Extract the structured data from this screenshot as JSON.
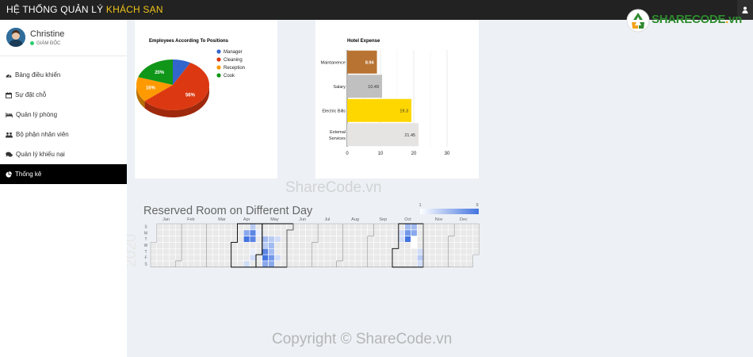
{
  "app": {
    "title_prefix": "HỆ THỐNG QUẢN LÝ",
    "title_highlight": "KHÁCH SẠN"
  },
  "watermark": {
    "logo_main": "SHARECODE",
    "logo_dot": ".",
    "logo_tld": "vn",
    "center_text": "ShareCode.vn",
    "copyright": "Copyright © ShareCode.vn"
  },
  "profile": {
    "name": "Christine",
    "role": "GIÁM ĐỐC"
  },
  "sidebar": {
    "items": [
      {
        "label": "Bảng điều khiển",
        "icon": "dashboard-icon"
      },
      {
        "label": "Sự đặt chỗ",
        "icon": "calendar-icon"
      },
      {
        "label": "Quản lý phòng",
        "icon": "bed-icon"
      },
      {
        "label": "Bộ phận nhân viên",
        "icon": "users-icon"
      },
      {
        "label": "Quản lý khiếu nại",
        "icon": "comments-icon"
      },
      {
        "label": "Thống kê",
        "icon": "pie-chart-icon"
      }
    ],
    "active_index": 5
  },
  "colors": {
    "accent": "#f0c419",
    "topbar": "#222222",
    "active_menu": "#000000",
    "online": "#2ecc71"
  },
  "chart_data": [
    {
      "type": "pie",
      "title": "Employees According To Positions",
      "categories": [
        "Manager",
        "Cleaning",
        "Reception",
        "Cook"
      ],
      "values": [
        8,
        56,
        16,
        20
      ],
      "labels": [
        "",
        "56%",
        "16%",
        "20%"
      ],
      "colors": [
        "#3366cc",
        "#dc3912",
        "#ff9900",
        "#109618"
      ],
      "legend": "right",
      "style": "3d"
    },
    {
      "type": "bar",
      "orientation": "horizontal",
      "title": "Hotel Expense",
      "categories": [
        "Maintanence",
        "Salary",
        "Electric Bills",
        "Extemal Services"
      ],
      "values": [
        8.94,
        10.49,
        19.3,
        21.45
      ],
      "labels": [
        "8.94",
        "10.49",
        "19.3",
        "21.45"
      ],
      "colors": [
        "#b87333",
        "#c0c0c0",
        "#ffd700",
        "#e5e4e2"
      ],
      "xlim": [
        0,
        30
      ],
      "xticks": [
        "0",
        "10",
        "20",
        "30"
      ],
      "grid": true
    },
    {
      "type": "heatmap",
      "subtype": "calendar",
      "title": "Reserved Room on Different Day",
      "year": "2020",
      "months": [
        "Jan",
        "Feb",
        "Mar",
        "Apr",
        "May",
        "Jun",
        "Jul",
        "Aug",
        "Sep",
        "Oct",
        "Nov",
        "Dec"
      ],
      "weekdays": [
        "S",
        "M",
        "T",
        "W",
        "T",
        "F",
        "S"
      ],
      "color_axis": {
        "min": "1",
        "max": "9",
        "min_color": "#ffffff",
        "max_color": "#4374e0"
      },
      "highlighted_months": [
        "Apr",
        "May",
        "Oct"
      ],
      "reservations": [
        {
          "date": "2020-04-13",
          "value": 6
        },
        {
          "date": "2020-04-14",
          "value": 9
        },
        {
          "date": "2020-04-18",
          "value": 3
        },
        {
          "date": "2020-04-19",
          "value": 4
        },
        {
          "date": "2020-04-20",
          "value": 8
        },
        {
          "date": "2020-04-21",
          "value": 8
        },
        {
          "date": "2020-04-23",
          "value": 2
        },
        {
          "date": "2020-04-24",
          "value": 3
        },
        {
          "date": "2020-04-27",
          "value": 2
        },
        {
          "date": "2020-05-05",
          "value": 5
        },
        {
          "date": "2020-05-06",
          "value": 4
        },
        {
          "date": "2020-05-07",
          "value": 8
        },
        {
          "date": "2020-05-08",
          "value": 9
        },
        {
          "date": "2020-05-09",
          "value": 6
        },
        {
          "date": "2020-05-12",
          "value": 4
        },
        {
          "date": "2020-05-13",
          "value": 5
        },
        {
          "date": "2020-05-14",
          "value": 5
        },
        {
          "date": "2020-05-15",
          "value": 7
        },
        {
          "date": "2020-05-16",
          "value": 6
        },
        {
          "date": "2020-05-19",
          "value": 3
        },
        {
          "date": "2020-05-22",
          "value": 3
        },
        {
          "date": "2020-10-05",
          "value": 3
        },
        {
          "date": "2020-10-06",
          "value": 3
        },
        {
          "date": "2020-10-11",
          "value": 5
        },
        {
          "date": "2020-10-12",
          "value": 7
        },
        {
          "date": "2020-10-13",
          "value": 9
        },
        {
          "date": "2020-10-18",
          "value": 5
        },
        {
          "date": "2020-10-19",
          "value": 6
        },
        {
          "date": "2020-10-20",
          "value": 1
        },
        {
          "date": "2020-10-21",
          "value": 1
        },
        {
          "date": "2020-10-29",
          "value": 3
        },
        {
          "date": "2020-10-30",
          "value": 4
        },
        {
          "date": "2020-10-31",
          "value": 3
        }
      ]
    }
  ]
}
